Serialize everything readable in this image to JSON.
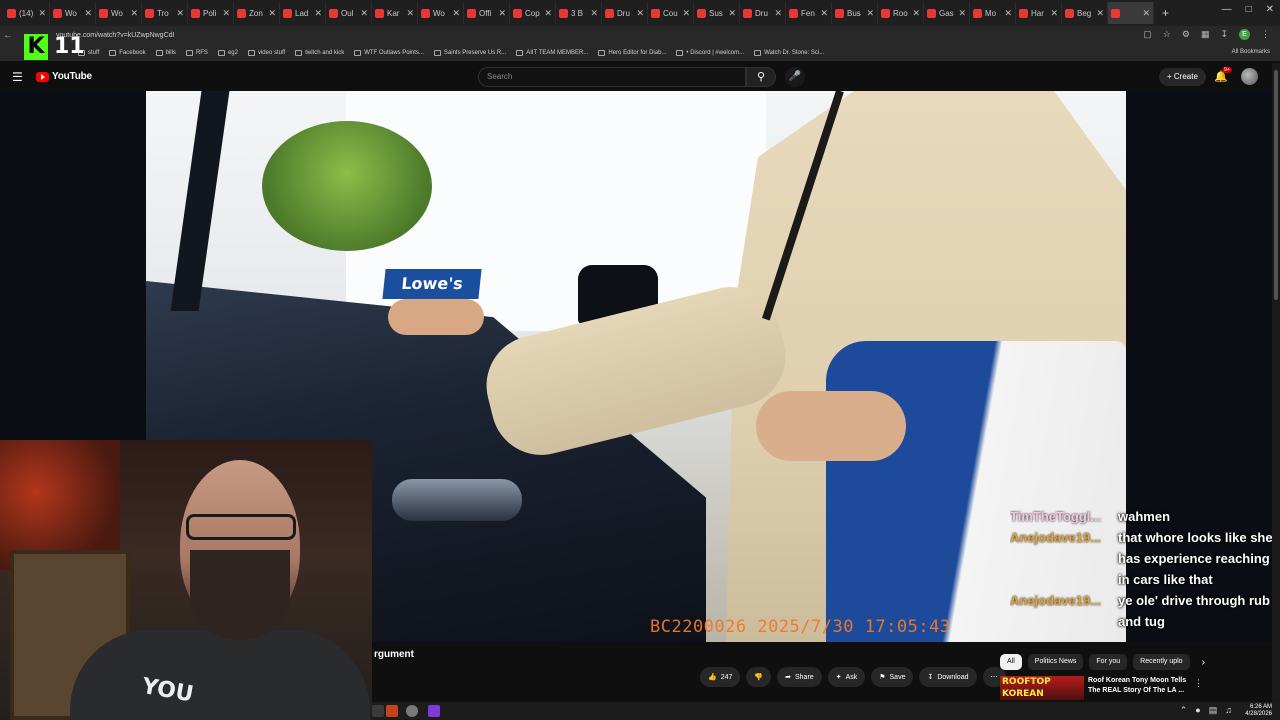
{
  "browser": {
    "tabs": [
      {
        "label": "(14)"
      },
      {
        "label": "Wo"
      },
      {
        "label": "Wo"
      },
      {
        "label": "Tro"
      },
      {
        "label": "Poli"
      },
      {
        "label": "Zon"
      },
      {
        "label": "Lad"
      },
      {
        "label": "Oul"
      },
      {
        "label": "Kar"
      },
      {
        "label": "Wo"
      },
      {
        "label": "Offi"
      },
      {
        "label": "Cop"
      },
      {
        "label": "3 B"
      },
      {
        "label": "Dru"
      },
      {
        "label": "Cou"
      },
      {
        "label": "Sus"
      },
      {
        "label": "Dru"
      },
      {
        "label": "Fen"
      },
      {
        "label": "Bus"
      },
      {
        "label": "Roo"
      },
      {
        "label": "Gas"
      },
      {
        "label": "Mo"
      },
      {
        "label": "Har"
      },
      {
        "label": "Beg"
      },
      {
        "label": ""
      }
    ],
    "url": "youtube.com/watch?v=kUZwpNwgCdI",
    "bookmarks": [
      "stuff",
      "Facebook",
      "bills",
      "RFS",
      "eg2",
      "video stuff",
      "twitch and kick",
      "WTF Outlaws Points...",
      "Saints Preserve Us R...",
      "AIIT TEAM MEMBER...",
      "Hero Editor for Diab...",
      "• Discord | #welcom...",
      "Watch Dr. Stone: Sci..."
    ],
    "all_bookmarks": "All Bookmarks"
  },
  "overlay": {
    "kick_letter": "K",
    "viewer_count": "11"
  },
  "youtube": {
    "logo_text": "YouTube",
    "search_placeholder": "Search",
    "create_label": "Create",
    "notif_badge": "9+"
  },
  "video": {
    "timestamp": "BC2200026  2025/7/30   17:05:43",
    "sign_text": "Lowe's",
    "title_partial": "rgument"
  },
  "webcam": {
    "shirt_text": "YOU"
  },
  "chat": [
    {
      "user": "TimTheToggl...",
      "msg": "wahmen",
      "user_color": "#f4c7dc"
    },
    {
      "user": "Anejodave19...",
      "msg": "that whore looks like she has experience reaching in cars like that",
      "user_color": "#e2a13c"
    },
    {
      "user": "Anejodave19...",
      "msg": "ye ole' drive through rub and tug",
      "user_color": "#e2a13c"
    }
  ],
  "actions": {
    "likes": "247",
    "share": "Share",
    "ask": "Ask",
    "save": "Save",
    "download": "Download"
  },
  "chips": {
    "items": [
      "All",
      "Politics News",
      "For you",
      "Recently uplo"
    ]
  },
  "recommendation": {
    "thumb_text": "ROOFTOP KOREAN",
    "title": "Roof Korean Tony Moon Tells The REAL Story Of The LA ..."
  },
  "taskbar": {
    "time": "6:26 AM",
    "date": "4/28/2026"
  }
}
